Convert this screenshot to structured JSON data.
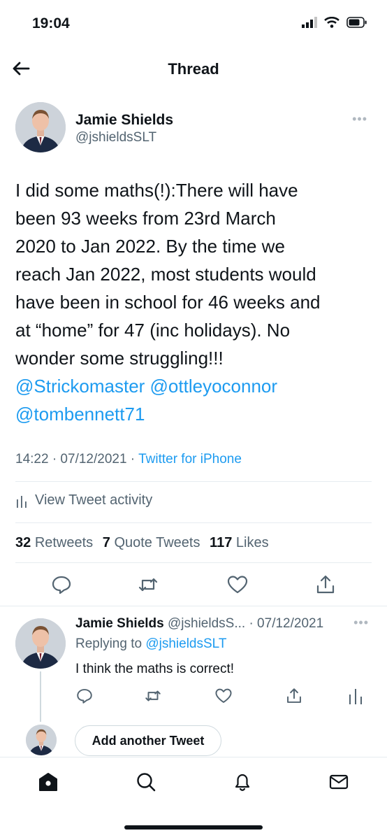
{
  "status_bar": {
    "time": "19:04"
  },
  "header": {
    "title": "Thread"
  },
  "tweet": {
    "author_name": "Jamie Shields",
    "author_handle": "@jshieldsSLT",
    "text_lines": [
      "I did some maths(!):There will have",
      "been 93 weeks from 23rd March",
      "2020 to Jan 2022.  By the time we",
      "reach Jan 2022, most students would",
      "have been in school for 46 weeks and",
      "at “home” for 47 (inc holidays).  No",
      "wonder some struggling!!!"
    ],
    "mentions_line1": "@Strickomaster @ottleyoconnor",
    "mentions_line2": "@tombennett71",
    "time_date": "14:22 · 07/12/2021 · ",
    "source": "Twitter for iPhone",
    "activity_label": "View Tweet activity",
    "retweets_count": "32",
    "retweets_label": "Retweets",
    "quotes_count": "7",
    "quotes_label": "Quote Tweets",
    "likes_count": "117",
    "likes_label": "Likes"
  },
  "reply": {
    "author_name": "Jamie Shields",
    "handle_date": " @jshieldsS... · 07/12/2021",
    "replying_prefix": "Replying to ",
    "replying_handle": "@jshieldsSLT",
    "text": "I think the maths is correct!"
  },
  "compose": {
    "button_label": "Add another Tweet"
  },
  "icons": {
    "back": "arrow-left-icon",
    "more": "more-icon",
    "reply": "reply-icon",
    "retweet": "retweet-icon",
    "like": "heart-icon",
    "share": "share-icon",
    "activity": "analytics-icon",
    "home": "home-icon",
    "search": "search-icon",
    "notifications": "bell-icon",
    "messages": "mail-icon"
  },
  "colors": {
    "link": "#1d9bf0",
    "secondary": "#536471",
    "text": "#0f1419"
  }
}
